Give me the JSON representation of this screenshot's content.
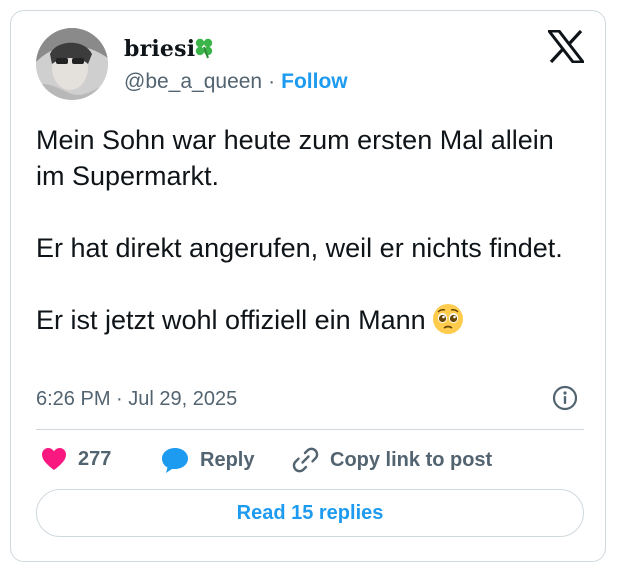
{
  "user": {
    "display_name": "briesi",
    "handle": "@be_a_queen",
    "separator": "·",
    "follow_label": "Follow",
    "badge_icon": "four-leaf-clover-icon"
  },
  "tweet": {
    "paragraphs": [
      "Mein Sohn war heute zum ersten Mal allein im Supermarkt.",
      "Er hat direkt angerufen, weil er nichts findet.",
      "Er ist jetzt wohl offiziell ein Mann"
    ],
    "emoji": "pleading-face-emoji",
    "timestamp": "6:26 PM · Jul 29, 2025"
  },
  "actions": {
    "like_count": "277",
    "reply_label": "Reply",
    "copy_label": "Copy link to post"
  },
  "footer": {
    "read_replies_label": "Read 15 replies"
  },
  "colors": {
    "accent": "#1d9bf0",
    "like": "#f91880",
    "muted": "#536471",
    "text": "#0f1419",
    "border": "#cfd9de"
  }
}
